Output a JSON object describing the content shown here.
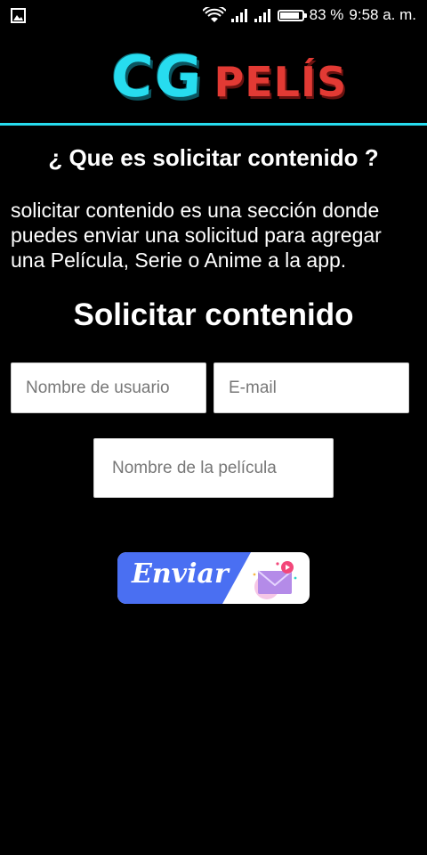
{
  "status_bar": {
    "battery": "83 %",
    "battery_level": 0.83,
    "time": "9:58 a. m."
  },
  "app": {
    "logo_cg": "CG",
    "logo_pelis": "PELÍS",
    "accent_color": "#27dcef",
    "brand_red": "#e23a34"
  },
  "info": {
    "question": "¿ Que es solicitar contenido ?",
    "description": "solicitar contenido es una sección donde puedes enviar una solicitud para agregar una Película, Serie o Anime a la app."
  },
  "form": {
    "title": "Solicitar contenido",
    "username_placeholder": "Nombre de usuario",
    "email_placeholder": "E-mail",
    "movie_placeholder": "Nombre de la película",
    "submit_label": "Enviar",
    "submit_color": "#4a6ff2"
  }
}
